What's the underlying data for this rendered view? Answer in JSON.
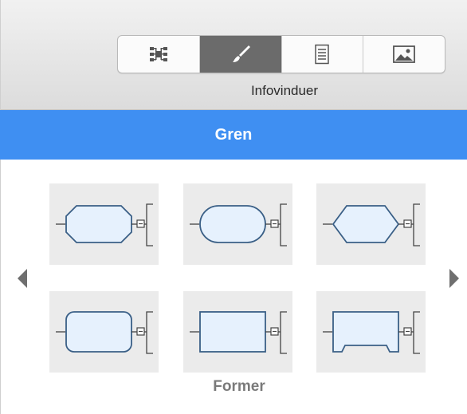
{
  "toolbar": {
    "label": "Infovinduer",
    "buttons": [
      {
        "name": "map-inspector-icon",
        "active": false
      },
      {
        "name": "brush-icon",
        "active": true
      },
      {
        "name": "notes-icon",
        "active": false
      },
      {
        "name": "image-icon",
        "active": false
      }
    ]
  },
  "header": {
    "title": "Gren"
  },
  "shapes": {
    "label": "Former",
    "items": [
      "octagon",
      "rounded-capsule",
      "hexagon",
      "rounded-rectangle",
      "rectangle",
      "notched-rectangle"
    ]
  },
  "colors": {
    "accent": "#3f8ff2",
    "shape_fill": "#e6f1fd",
    "shape_stroke": "#3a5f86",
    "tile_bg": "#ebebeb"
  }
}
